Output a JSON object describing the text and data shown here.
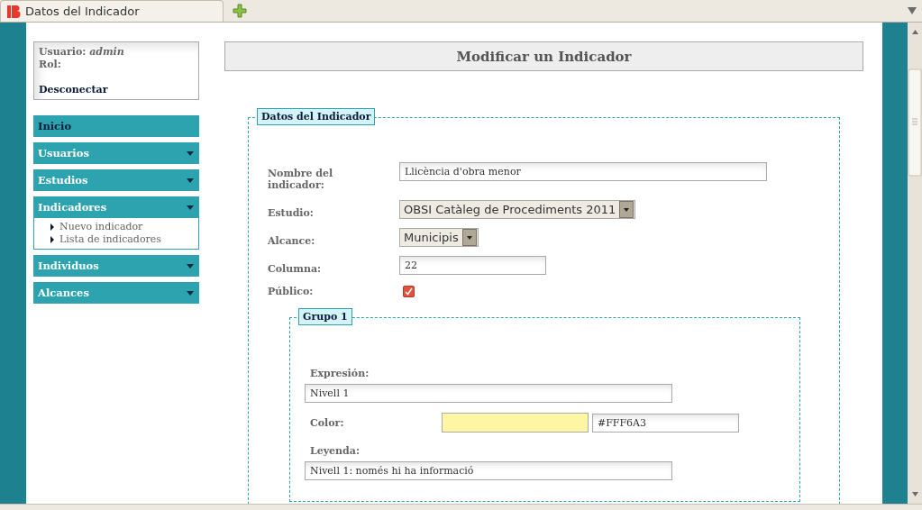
{
  "tab": {
    "title": "Datos del Indicador",
    "selected": true
  },
  "user_box": {
    "user_line": "Usuario: *admin*",
    "role_label": "Rol:",
    "logout": "Desconectar"
  },
  "menu": [
    {
      "label": "Inicio",
      "kind": "link"
    },
    {
      "label": "Usuarios",
      "kind": "dropdown",
      "expanded": false
    },
    {
      "label": "Estudios",
      "kind": "dropdown",
      "expanded": false
    },
    {
      "label": "Indicadores",
      "kind": "dropdown",
      "expanded": true,
      "children": [
        {
          "label": "Nuevo indicador"
        },
        {
          "label": "Lista de indicadores"
        }
      ]
    },
    {
      "label": "Individuos",
      "kind": "dropdown",
      "expanded": false
    },
    {
      "label": "Alcances",
      "kind": "dropdown",
      "expanded": false
    }
  ],
  "header": {
    "title": "Modificar un Indicador"
  },
  "form": {
    "legend": "Datos del Indicador",
    "fields": [
      {
        "kind": "text",
        "label": "Nombre del indicador:",
        "value": "Llicència d'obra menor"
      },
      {
        "kind": "select",
        "label": "Estudio:",
        "value": "OBSI Catàleg de Procediments 2011"
      },
      {
        "kind": "select",
        "label": "Alcance:",
        "value": "Municipis"
      },
      {
        "kind": "short",
        "label": "Columna:",
        "value": "22"
      },
      {
        "kind": "checkbox",
        "label": "Público:",
        "checked": true
      }
    ]
  },
  "group": {
    "legend": "Grupo 1",
    "expression_label": "Expresión:",
    "expression": "Nivell 1",
    "color_label": "Color:",
    "color": "#fff6a3",
    "color_value": "#FFF6A3",
    "legend_label": "Leyenda:",
    "legend_text": "Nivell 1: només hi ha informació"
  }
}
